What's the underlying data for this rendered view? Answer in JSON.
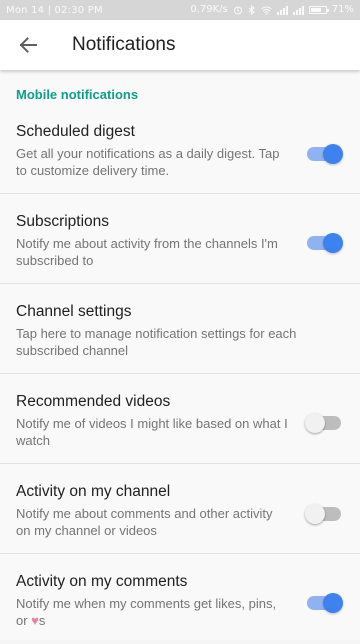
{
  "status_bar": {
    "time": "Mon 14 | 02:30 PM",
    "speed": "0.79K/s",
    "battery": "71%",
    "battery_level": 0.71
  },
  "app_bar": {
    "title": "Notifications",
    "back_icon": "arrow-back-icon"
  },
  "section": {
    "header": "Mobile notifications"
  },
  "settings": [
    {
      "title": "Scheduled digest",
      "desc": "Get all your notifications as a daily digest. Tap to customize delivery time.",
      "toggle": "on"
    },
    {
      "title": "Subscriptions",
      "desc": "Notify me about activity from the channels I'm subscribed to",
      "toggle": "on"
    },
    {
      "title": "Channel settings",
      "desc": "Tap here to manage notification settings for each subscribed channel",
      "toggle": null
    },
    {
      "title": "Recommended videos",
      "desc": "Notify me of videos I might like based on what I watch",
      "toggle": "off"
    },
    {
      "title": "Activity on my channel",
      "desc": "Notify me about comments and other activity on my channel or videos",
      "toggle": "off"
    },
    {
      "title": "Activity on my comments",
      "desc_before": "Notify me when my comments get likes, pins, or ",
      "desc_heart": "♥",
      "desc_after": "s",
      "toggle": "on"
    }
  ],
  "colors": {
    "accent": "#0f9d8a",
    "toggle_on_knob": "#3e82f0",
    "toggle_on_track": "#8fb3f2",
    "toggle_off_knob": "#f1f1f1",
    "toggle_off_track": "#bdbdbd",
    "heart": "#ef7fa8"
  }
}
